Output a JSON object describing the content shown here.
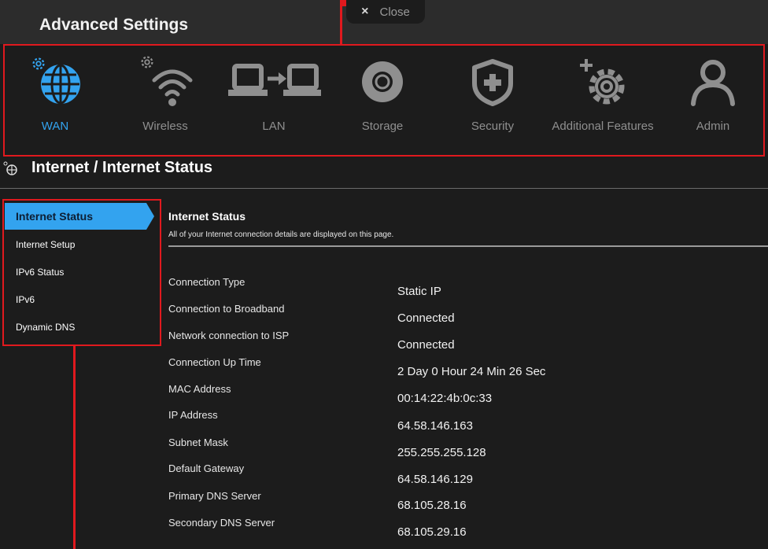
{
  "header": {
    "title": "Advanced Settings",
    "close_label": "Close",
    "close_icon": "×"
  },
  "nav": {
    "items": [
      {
        "label": "WAN",
        "icon": "globe-icon",
        "active": true
      },
      {
        "label": "Wireless",
        "icon": "wifi-icon",
        "active": false
      },
      {
        "label": "LAN",
        "icon": "lan-icon",
        "active": false
      },
      {
        "label": "Storage",
        "icon": "storage-icon",
        "active": false
      },
      {
        "label": "Security",
        "icon": "shield-icon",
        "active": false
      },
      {
        "label": "Additional Features",
        "icon": "gear-plus-icon",
        "active": false
      },
      {
        "label": "Admin",
        "icon": "user-icon",
        "active": false
      }
    ]
  },
  "breadcrumb": {
    "title": "Internet / Internet Status"
  },
  "sidebar": {
    "items": [
      {
        "label": "Internet Status",
        "active": true
      },
      {
        "label": "Internet Setup",
        "active": false
      },
      {
        "label": "IPv6 Status",
        "active": false
      },
      {
        "label": "IPv6",
        "active": false
      },
      {
        "label": "Dynamic DNS",
        "active": false
      }
    ]
  },
  "content": {
    "title": "Internet Status",
    "subtitle": "All of your Internet connection details are displayed on this page.",
    "fields": [
      {
        "label": "Connection Type",
        "value": "Static IP"
      },
      {
        "label": "Connection to Broadband",
        "value": "Connected"
      },
      {
        "label": "Network connection to ISP",
        "value": "Connected"
      },
      {
        "label": "Connection Up Time",
        "value": "2 Day 0 Hour 24 Min 26 Sec"
      },
      {
        "label": "MAC Address",
        "value": "00:14:22:4b:0c:33"
      },
      {
        "label": "IP Address",
        "value": "64.58.146.163"
      },
      {
        "label": "Subnet Mask",
        "value": "255.255.255.128"
      },
      {
        "label": "Default Gateway",
        "value": "64.58.146.129"
      },
      {
        "label": "Primary DNS Server",
        "value": "68.105.28.16"
      },
      {
        "label": "Secondary DNS Server",
        "value": "68.105.29.16"
      }
    ]
  },
  "colors": {
    "accent": "#33a3ef",
    "background": "#1c1c1c",
    "header": "#2c2c2c",
    "annotation": "#e0191e",
    "inactive_icon": "#8f8f8f"
  }
}
